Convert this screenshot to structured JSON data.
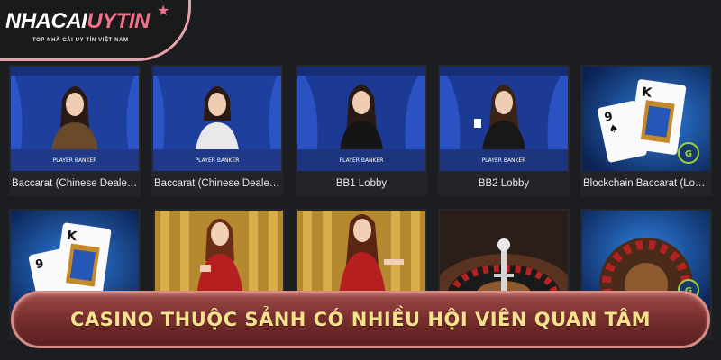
{
  "brand": {
    "logo_part1": "NHACAI",
    "logo_part2": "UYTIN",
    "tagline": "TOP NHÀ CÁI UY TÍN VIỆT NAM",
    "accent_color": "#f0728a"
  },
  "games": [
    {
      "label": "Baccarat (Chinese Dealer L...",
      "thumb": "dealer-baccarat"
    },
    {
      "label": "Baccarat (Chinese Dealer L...",
      "thumb": "dealer-baccarat"
    },
    {
      "label": "BB1 Lobby",
      "thumb": "dealer-baccarat"
    },
    {
      "label": "BB2 Lobby",
      "thumb": "dealer-baccarat"
    },
    {
      "label": "Blockchain Baccarat (Lobby...",
      "thumb": "playing-cards"
    },
    {
      "label": "",
      "thumb": "playing-cards"
    },
    {
      "label": "",
      "thumb": "dealer-gold"
    },
    {
      "label": "",
      "thumb": "dealer-gold"
    },
    {
      "label": "",
      "thumb": "roulette-wheel"
    },
    {
      "label": "",
      "thumb": "roulette-wheel"
    }
  ],
  "banner": {
    "text": "CASINO THUỘC SẢNH CÓ NHIỀU HỘI VIÊN QUAN TÂM"
  }
}
